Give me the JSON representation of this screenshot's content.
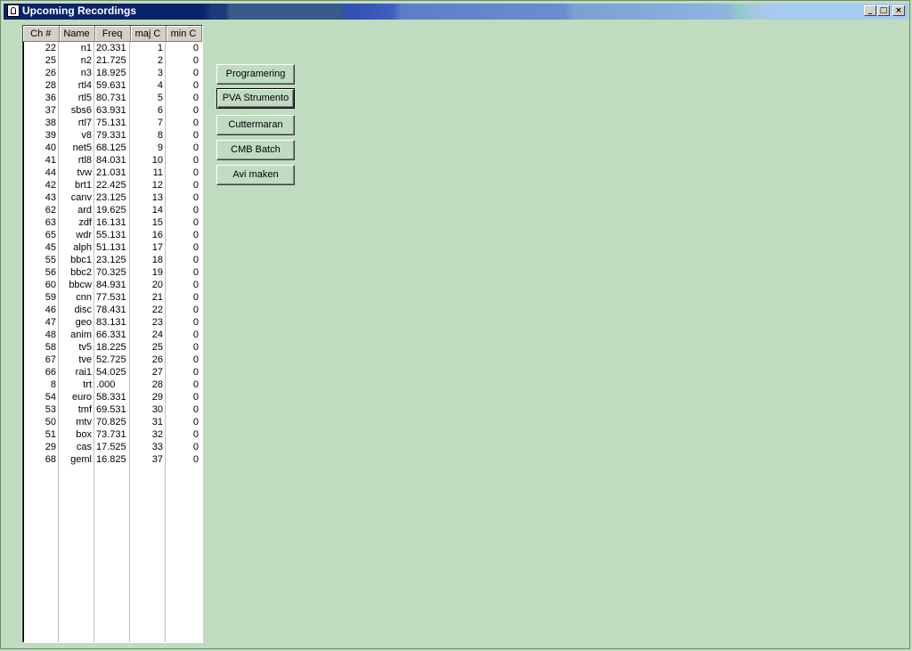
{
  "window": {
    "title": "Upcoming Recordings",
    "minimize_glyph": "_",
    "maximize_glyph": "□",
    "close_glyph": "×"
  },
  "table": {
    "headers": [
      "Ch #",
      "Name",
      "Freq",
      "maj C",
      "min C"
    ],
    "rows": [
      [
        "22",
        "n1",
        "20.331",
        "1",
        "0"
      ],
      [
        "25",
        "n2",
        "21.725",
        "2",
        "0"
      ],
      [
        "26",
        "n3",
        "18.925",
        "3",
        "0"
      ],
      [
        "28",
        "rtl4",
        "59.631",
        "4",
        "0"
      ],
      [
        "36",
        "rtl5",
        "80.731",
        "5",
        "0"
      ],
      [
        "37",
        "sbs6",
        "63.931",
        "6",
        "0"
      ],
      [
        "38",
        "rtl7",
        "75.131",
        "7",
        "0"
      ],
      [
        "39",
        "v8",
        "79.331",
        "8",
        "0"
      ],
      [
        "40",
        "net5",
        "68.125",
        "9",
        "0"
      ],
      [
        "41",
        "rtl8",
        "84.031",
        "10",
        "0"
      ],
      [
        "44",
        "tvw",
        "21.031",
        "11",
        "0"
      ],
      [
        "42",
        "brt1",
        "22.425",
        "12",
        "0"
      ],
      [
        "43",
        "canv",
        "23.125",
        "13",
        "0"
      ],
      [
        "62",
        "ard",
        "19.625",
        "14",
        "0"
      ],
      [
        "63",
        "zdf",
        "16.131",
        "15",
        "0"
      ],
      [
        "65",
        "wdr",
        "55.131",
        "16",
        "0"
      ],
      [
        "45",
        "alph",
        "51.131",
        "17",
        "0"
      ],
      [
        "55",
        "bbc1",
        "23.125",
        "18",
        "0"
      ],
      [
        "56",
        "bbc2",
        "70.325",
        "19",
        "0"
      ],
      [
        "60",
        "bbcw",
        "84.931",
        "20",
        "0"
      ],
      [
        "59",
        "cnn",
        "77.531",
        "21",
        "0"
      ],
      [
        "46",
        "disc",
        "78.431",
        "22",
        "0"
      ],
      [
        "47",
        "geo",
        "83.131",
        "23",
        "0"
      ],
      [
        "48",
        "anim",
        "66.331",
        "24",
        "0"
      ],
      [
        "58",
        "tv5",
        "18.225",
        "25",
        "0"
      ],
      [
        "67",
        "tve",
        "52.725",
        "26",
        "0"
      ],
      [
        "66",
        "rai1",
        "54.025",
        "27",
        "0"
      ],
      [
        "8",
        "trt",
        ".000",
        "28",
        "0"
      ],
      [
        "54",
        "euro",
        "58.331",
        "29",
        "0"
      ],
      [
        "53",
        "tmf",
        "69.531",
        "30",
        "0"
      ],
      [
        "50",
        "mtv",
        "70.825",
        "31",
        "0"
      ],
      [
        "51",
        "box",
        "73.731",
        "32",
        "0"
      ],
      [
        "29",
        "cas",
        "17.525",
        "33",
        "0"
      ],
      [
        "68",
        "geml",
        "16.825",
        "37",
        "0"
      ]
    ]
  },
  "buttons": [
    {
      "name": "programering-button",
      "label": "Programering"
    },
    {
      "name": "pva-strumento-button",
      "label": "PVA Strumento",
      "focused": true
    },
    {
      "name": "cuttermaran-button",
      "label": "Cuttermaran"
    },
    {
      "name": "cmb-batch-button",
      "label": "CMB Batch"
    },
    {
      "name": "avi-maken-button",
      "label": "Avi maken"
    }
  ]
}
